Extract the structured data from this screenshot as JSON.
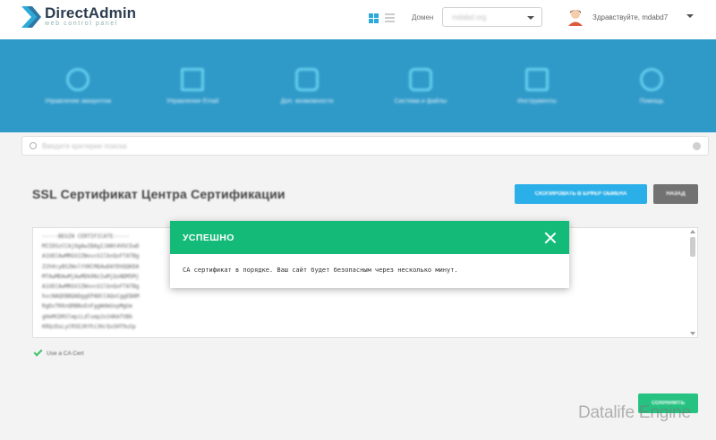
{
  "header": {
    "logo_text": "DirectAdmin",
    "logo_sub": "web control panel",
    "domain_label": "Домен",
    "domain_value": "mdabd.org",
    "greeting": "Здравствуйте, mdabd7",
    "accent": "#1e91c4"
  },
  "nav": {
    "items": [
      {
        "label": "Управление аккаунтом",
        "icon": "account-icon"
      },
      {
        "label": "Управление Email",
        "icon": "email-icon"
      },
      {
        "label": "Доп. возможности",
        "icon": "features-icon"
      },
      {
        "label": "Система и файлы",
        "icon": "folder-icon"
      },
      {
        "label": "Инструменты",
        "icon": "tools-icon"
      },
      {
        "label": "Помощь",
        "icon": "help-icon"
      }
    ]
  },
  "search": {
    "placeholder": "Введите критерии поиска"
  },
  "content": {
    "title": "SSL Сертификат Центра Сертификации",
    "copy_button": "СКОПИРОВАТЬ В БУФЕР ОБМЕНА",
    "back_button": "НАЗАД",
    "cert_lines": [
      "-----BEGIN CERTIFICATE-----",
      "MIIDSzCCAjOgAwIBAgIJANt4VGCEwD",
      "A1UECAwMRGV2ZWxvcG1lbnQxFTATBg",
      "Z2h0cyBSZWxlYXNlMQ4wDAYDVQQKDA",
      "MTAwMDAwMjAwMDk0NzIwMjQxNDM5Mj",
      "A1UECAwMRGV2ZWxvcG1lbnQxFTATBg",
      "hvcNAQEBBQADggEPADCCAQoCggEBAM",
      "RgDxTKKnQRBNxEnFggWdmUxpMgUe",
      "gHeMCDRSlmpiLdlsmp2o34KmTVBk",
      "KRQzDsLyCR5E2KYhi3H/QsSHT9uSp"
    ],
    "use_ca_label": "Use a CA Cert",
    "save_button": "СОХРАНИТЬ"
  },
  "modal": {
    "title": "УСПЕШНО",
    "message": "CA сертификат в порядке. Ваш сайт будет безопасным через несколько минут.",
    "color": "#14bb78"
  },
  "watermark": "Datalife Engine"
}
